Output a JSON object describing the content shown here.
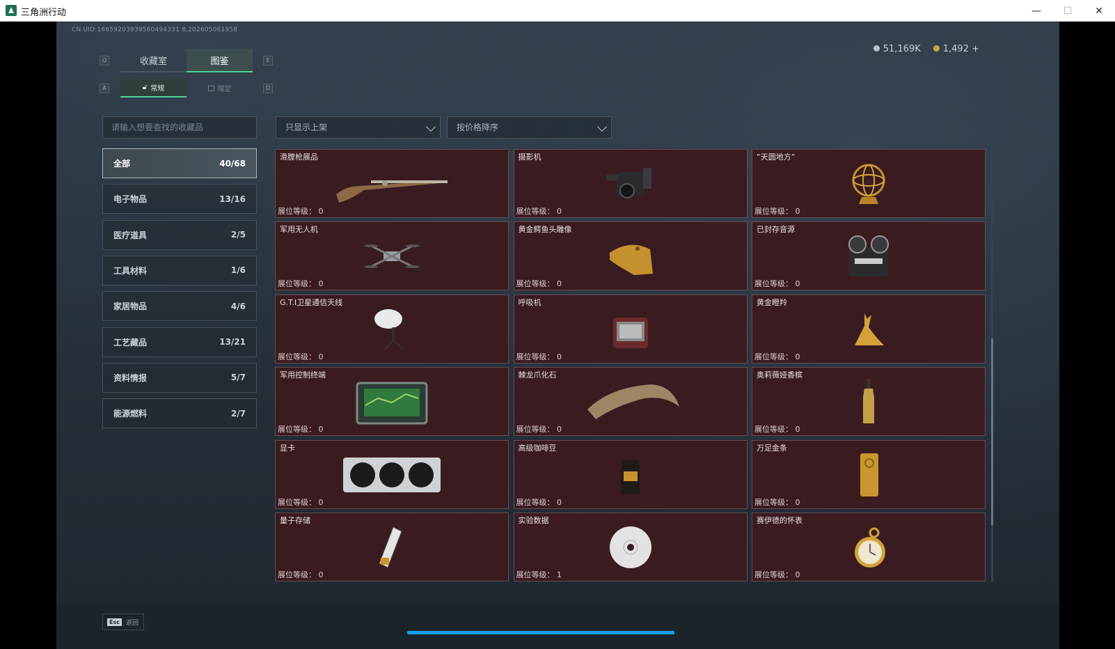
{
  "window": {
    "title": "三角洲行动",
    "minimize": "—",
    "maximize": "☐",
    "close": "✕"
  },
  "header": {
    "uid": "CN UID:16659203939560494331 8,202605061958",
    "currency": [
      {
        "value": "51,169K",
        "color": "#b9c3ca"
      },
      {
        "value": "1,492 +",
        "color": "#c9a948"
      }
    ]
  },
  "tabs": {
    "prev_key": "Q",
    "next_key": "E",
    "items": [
      {
        "label": "收藏室",
        "active": false
      },
      {
        "label": "图鉴",
        "active": true
      }
    ]
  },
  "subtabs": {
    "prev_key": "A",
    "next_key": "D",
    "items": [
      {
        "label": "常规",
        "icon": "lock-open-icon",
        "active": true
      },
      {
        "label": "限定",
        "icon": "image-icon",
        "active": false
      }
    ]
  },
  "filters": {
    "search_placeholder": "请输入想要查找的收藏品",
    "shelf_filter": "只显示上架",
    "sort": "按价格降序"
  },
  "categories": [
    {
      "label": "全部",
      "count": "40/68",
      "active": true
    },
    {
      "label": "电子物品",
      "count": "13/16",
      "active": false
    },
    {
      "label": "医疗道具",
      "count": "2/5",
      "active": false
    },
    {
      "label": "工具材料",
      "count": "1/6",
      "active": false
    },
    {
      "label": "家居物品",
      "count": "4/6",
      "active": false
    },
    {
      "label": "工艺藏品",
      "count": "13/21",
      "active": false
    },
    {
      "label": "资料情报",
      "count": "5/7",
      "active": false
    },
    {
      "label": "能源燃料",
      "count": "2/7",
      "active": false
    }
  ],
  "level_prefix": "展位等级：",
  "items": [
    {
      "name": "滑膛枪展品",
      "level": "0",
      "icon": "musket-icon"
    },
    {
      "name": "摄影机",
      "level": "0",
      "icon": "camera-icon"
    },
    {
      "name": "“天圆地方”",
      "level": "0",
      "icon": "armillary-sphere-icon"
    },
    {
      "name": "军用无人机",
      "level": "0",
      "icon": "drone-icon"
    },
    {
      "name": "黄金鳄鱼头雕像",
      "level": "0",
      "icon": "crocodile-head-icon"
    },
    {
      "name": "已封存音源",
      "level": "0",
      "icon": "reel-recorder-icon"
    },
    {
      "name": "G.T.I卫星通信天线",
      "level": "0",
      "icon": "satellite-dish-icon"
    },
    {
      "name": "呼吸机",
      "level": "0",
      "icon": "ventilator-icon"
    },
    {
      "name": "黄金瞪羚",
      "level": "0",
      "icon": "gazelle-icon"
    },
    {
      "name": "军用控制终端",
      "level": "0",
      "icon": "terminal-icon"
    },
    {
      "name": "棘龙爪化石",
      "level": "0",
      "icon": "claw-fossil-icon"
    },
    {
      "name": "奥莉薇娅香槟",
      "level": "0",
      "icon": "champagne-icon"
    },
    {
      "name": "显卡",
      "level": "0",
      "icon": "graphics-card-icon"
    },
    {
      "name": "高级咖啡豆",
      "level": "0",
      "icon": "coffee-bag-icon"
    },
    {
      "name": "万足金条",
      "level": "0",
      "icon": "gold-bar-icon"
    },
    {
      "name": "量子存储",
      "level": "0",
      "icon": "quantum-storage-icon"
    },
    {
      "name": "实验数据",
      "level": "1",
      "icon": "disc-icon"
    },
    {
      "name": "赛伊德的怀表",
      "level": "0",
      "icon": "pocket-watch-icon"
    }
  ],
  "footer": {
    "esc_key": "Esc",
    "back_label": "返回"
  }
}
